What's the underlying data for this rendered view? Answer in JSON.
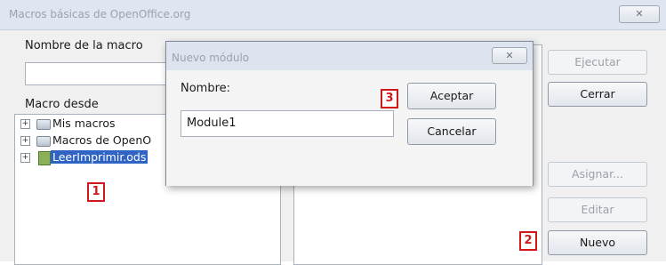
{
  "main_dialog": {
    "title": "Macros básicas de OpenOffice.org",
    "close_icon": "close-icon",
    "labels": {
      "macro_name": "Nombre de la macro",
      "macro_from": "Macro desde"
    },
    "macro_name_value": "",
    "tree": [
      {
        "label": "Mis macros",
        "icon": "library-icon"
      },
      {
        "label": "Macros de OpenO",
        "icon": "library-icon"
      },
      {
        "label": "LeerImprimir.ods",
        "icon": "spreadsheet-document-icon",
        "selected": true
      }
    ],
    "buttons": {
      "run": "Ejecutar",
      "close": "Cerrar",
      "assign": "Asignar...",
      "edit": "Editar",
      "new": "Nuevo"
    }
  },
  "modal": {
    "title": "Nuevo módulo",
    "close_icon": "close-icon",
    "name_label": "Nombre:",
    "name_value": "Module1",
    "buttons": {
      "ok": "Aceptar",
      "cancel": "Cancelar"
    }
  },
  "markers": [
    "1",
    "2",
    "3"
  ],
  "colors": {
    "marker": "#d01818",
    "selection": "#2f64c5"
  }
}
